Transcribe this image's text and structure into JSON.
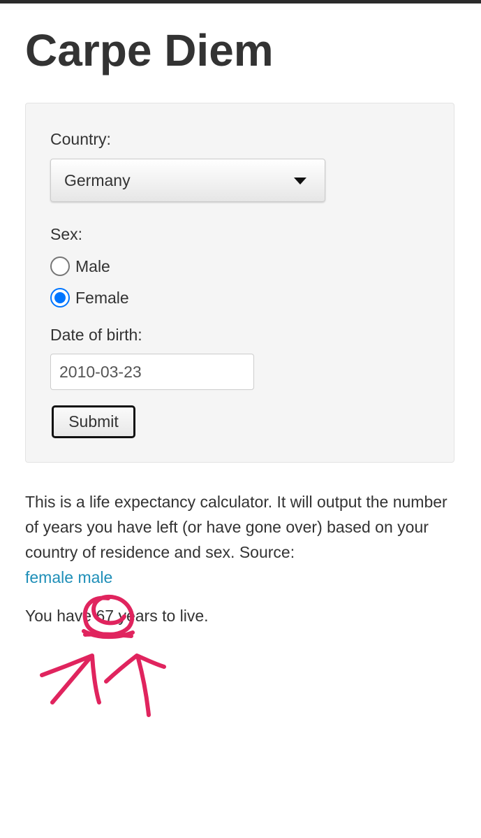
{
  "page": {
    "title": "Carpe Diem"
  },
  "form": {
    "country_label": "Country:",
    "country_value": "Germany",
    "sex_label": "Sex:",
    "sex_options": [
      {
        "label": "Male",
        "checked": false
      },
      {
        "label": "Female",
        "checked": true
      }
    ],
    "dob_label": "Date of birth:",
    "dob_value": "2010-03-23",
    "submit_label": "Submit"
  },
  "description": {
    "text": "This is a life expectancy calculator. It will output the number of years you have left (or have gone over) based on your country of residence and sex. Source:",
    "link_female": "female",
    "link_male": "male"
  },
  "result": {
    "prefix": "You have",
    "years": "67",
    "suffix": "years to live."
  },
  "colors": {
    "accent_radio": "#0075ff",
    "link": "#1f8fb8",
    "annotation": "#e0245e"
  },
  "icons": {
    "select_caret": "caret-down-icon"
  }
}
